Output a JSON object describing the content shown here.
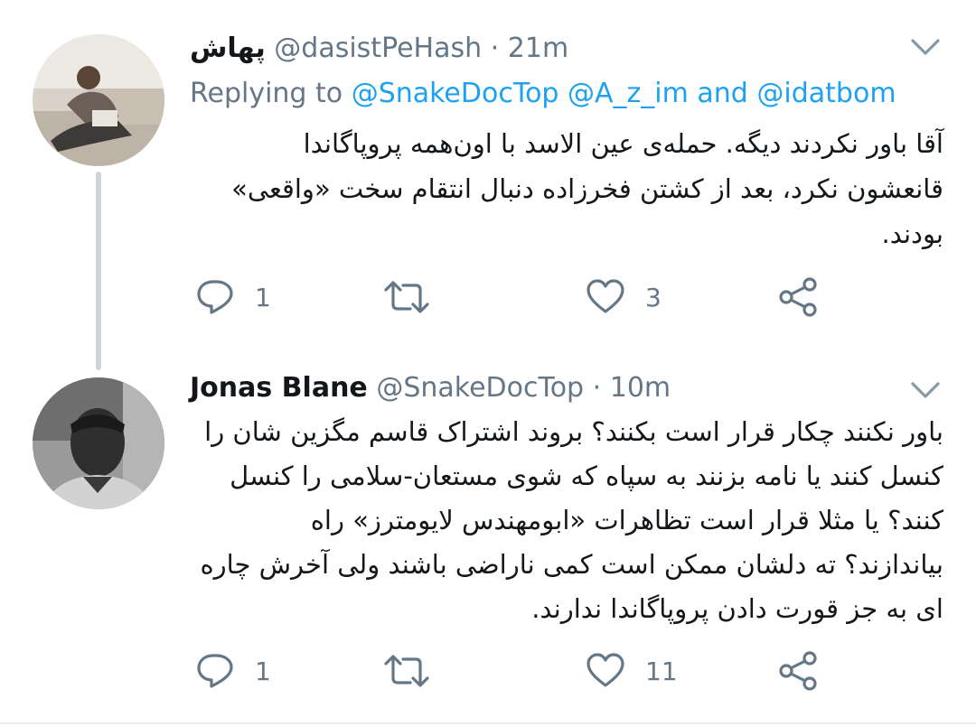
{
  "tweets": [
    {
      "display_name": "پهاش",
      "handle": "@dasistPeHash",
      "separator": "·",
      "time": "21m",
      "replying_prefix": "Replying to",
      "replying_mentions": [
        "@SnakeDocTop",
        "@A_z_im",
        "@idatbom"
      ],
      "replying_and": "and",
      "body_lines": [
        "آقا باور نکردند دیگه. حمله‌ی عین الاسد با اون‌همه پروپاگاندا",
        "قانعشون نکرد، بعد از کشتن فخرزاده دنبال انتقام سخت «واقعی»",
        "بودند."
      ],
      "reply_count": "1",
      "retweet_count": "",
      "like_count": "3"
    },
    {
      "display_name": "Jonas Blane",
      "handle": "@SnakeDocTop",
      "separator": "·",
      "time": "10m",
      "body_lines": [
        "باور نکنند چکار قرار است بکنند؟ بروند اشتراک قاسم مگزین شان را",
        "کنسل کنند یا نامه بزنند به سپاه که شوی مستعان-سلامی را کنسل",
        "کنند؟ یا مثلا قرار است تظاهرات «ابومهندس لایومترز» راه",
        "بیاندازند؟ ته دلشان ممکن است کمی ناراضی باشند ولی آخرش چاره",
        "ای به جز قورت دادن پروپاگاندا ندارند."
      ],
      "reply_count": "1",
      "retweet_count": "",
      "like_count": "11"
    }
  ],
  "icons": {
    "reply": "reply-icon",
    "retweet": "retweet-icon",
    "like": "heart-icon",
    "share": "share-icon",
    "menu": "chevron-down-icon"
  },
  "colors": {
    "text": "#14171a",
    "secondary": "#657786",
    "link": "#1da1f2",
    "thread_line": "#ccd6dd"
  }
}
